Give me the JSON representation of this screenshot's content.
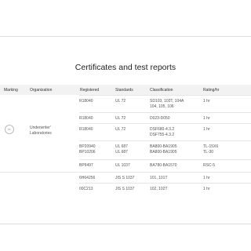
{
  "page": {
    "title": "Certificates and test reports"
  },
  "table": {
    "headers": [
      "Marking",
      "Organization",
      "Registered",
      "Standards",
      "Classification",
      "Rating/hr"
    ],
    "group": {
      "marking_icon": "ul-mark-icon",
      "marking_label": "UL",
      "organization": "Underwriter'\nLaboratories"
    },
    "rows": [
      {
        "registered": "R18040",
        "standards": "UL 72",
        "classification": "SD103, 103T, 104A\n104, 105, 106",
        "rating": "1 hr"
      },
      {
        "registered": "R18040",
        "standards": "UL 72",
        "classification": "D023-D050",
        "rating": "1 hr"
      },
      {
        "registered": "R18040",
        "standards": "UL 72",
        "classification": "DSF680-4.3.2\nDSF755-4.3.2",
        "rating": "1 hr"
      },
      {
        "registered": "BP20940\nBP10206",
        "standards": "UL 687\nUL 687",
        "classification": "BA800-BA1905\nBA800-BA1905",
        "rating": "TL-15X6\nTL-30"
      },
      {
        "registered": "BP9497",
        "standards": "UL 1037",
        "classification": "BA780-BA1570",
        "rating": "RSC-5"
      },
      {
        "registered": "6H64256",
        "standards": "JIS S 1037",
        "classification": "101, 101T",
        "rating": "1 hr"
      },
      {
        "registered": "00C213",
        "standards": "JIS S 1037",
        "classification": "102, 102T",
        "rating": "1 hr"
      }
    ]
  }
}
